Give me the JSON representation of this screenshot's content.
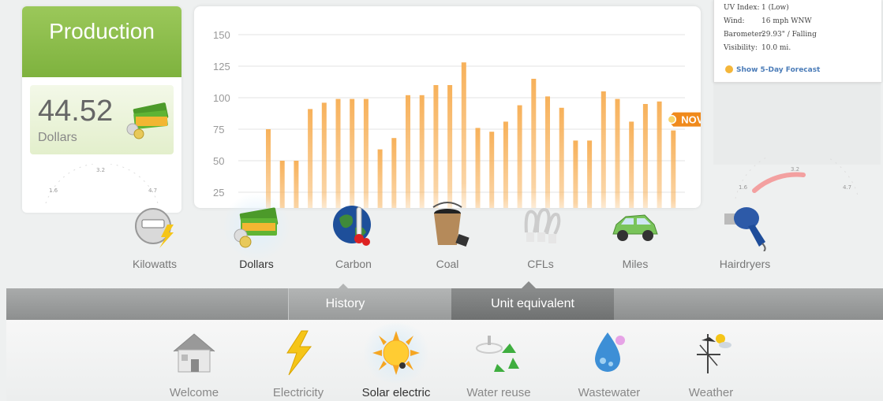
{
  "production": {
    "title": "Production",
    "value": "44.52",
    "unit": "Dollars",
    "gauge_ticks": [
      "1.6",
      "3.2",
      "4.7"
    ]
  },
  "weather": {
    "rows": [
      {
        "key": "UV Index:",
        "value": "1 (Low)"
      },
      {
        "key": "Wind:",
        "value": "16 mph WNW"
      },
      {
        "key": "Barometer:",
        "value": "29.93\" / Falling"
      },
      {
        "key": "Visibility:",
        "value": "10.0 mi."
      }
    ],
    "forecast_link": "Show 5-Day Forecast",
    "gauge_ticks": [
      "1.6",
      "3.2",
      "4.7"
    ]
  },
  "chart_data": {
    "type": "bar",
    "yticks": [
      25,
      50,
      75,
      100,
      125,
      150
    ],
    "ylim": [
      0,
      150
    ],
    "values": [
      75,
      50,
      50,
      91,
      96,
      99,
      99,
      99,
      59,
      68,
      102,
      102,
      110,
      110,
      128,
      76,
      73,
      81,
      94,
      115,
      101,
      92,
      66,
      66,
      105,
      99,
      81,
      95,
      97,
      74
    ],
    "marker_label": "NOV",
    "bar_color": "#f7b15a",
    "accent_color": "#f08a1c"
  },
  "units": [
    {
      "label": "Kilowatts",
      "icon": "meter-icon"
    },
    {
      "label": "Dollars",
      "icon": "money-icon"
    },
    {
      "label": "Carbon",
      "icon": "globe-thermometer-icon"
    },
    {
      "label": "Coal",
      "icon": "coal-bucket-icon"
    },
    {
      "label": "CFLs",
      "icon": "cfl-bulb-icon"
    },
    {
      "label": "Miles",
      "icon": "car-icon"
    },
    {
      "label": "Hairdryers",
      "icon": "hairdryer-icon"
    }
  ],
  "tabs": {
    "history": "History",
    "unit_equivalent": "Unit equivalent"
  },
  "nav": [
    {
      "label": "Welcome",
      "icon": "house-icon"
    },
    {
      "label": "Electricity",
      "icon": "lightning-icon"
    },
    {
      "label": "Solar electric",
      "icon": "sun-icon"
    },
    {
      "label": "Water reuse",
      "icon": "recycle-faucet-icon"
    },
    {
      "label": "Wastewater",
      "icon": "water-drop-icon"
    },
    {
      "label": "Weather",
      "icon": "weather-vane-icon"
    }
  ],
  "colors": {
    "production_green": "#8ebe4c",
    "tab_gray": "#8d8f8f",
    "link_blue": "#4b7cb8"
  }
}
